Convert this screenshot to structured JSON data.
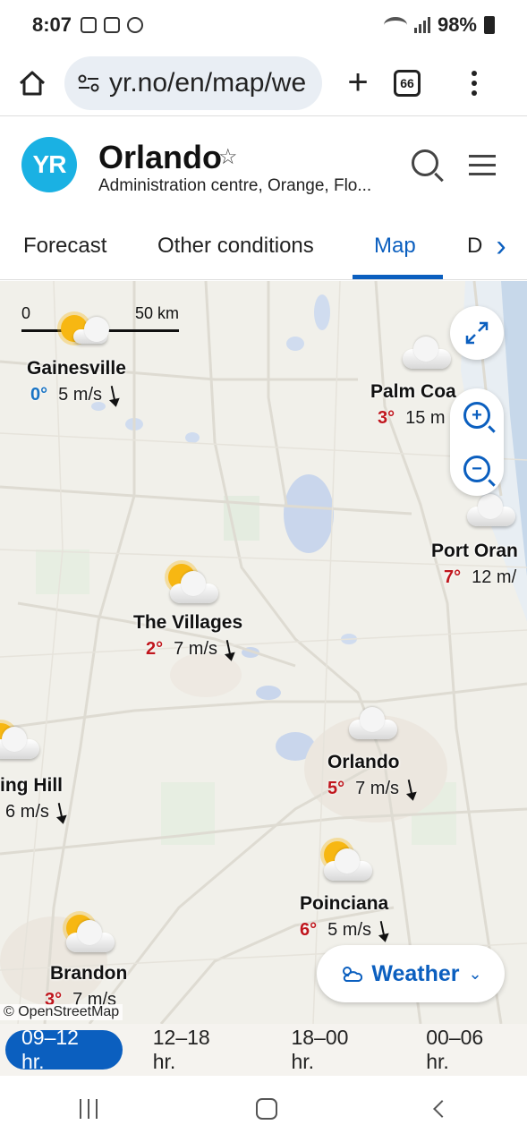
{
  "status_bar": {
    "time": "8:07",
    "battery": "98%"
  },
  "browser": {
    "url": "yr.no/en/map/we",
    "tabs_count": "66"
  },
  "header": {
    "logo_text": "YR",
    "city": "Orlando",
    "subtitle": "Administration centre, Orange, Flo..."
  },
  "nav_tabs": [
    {
      "label": "Forecast"
    },
    {
      "label": "Other conditions"
    },
    {
      "label": "Map"
    },
    {
      "label": "D"
    }
  ],
  "active_tab": "Map",
  "map": {
    "scale": {
      "zero": "0",
      "distance": "50 km"
    },
    "places": [
      {
        "name": "Gainesville",
        "temp": "0°",
        "wind": "5 m/s",
        "condition": "partly-cloudy"
      },
      {
        "name": "Palm Coa",
        "temp": "3°",
        "wind": "15 m",
        "condition": "cloudy"
      },
      {
        "name": "Port Oran",
        "temp": "7°",
        "wind": "12 m/",
        "condition": "cloudy"
      },
      {
        "name": "The Villages",
        "temp": "2°",
        "wind": "7 m/s",
        "condition": "partly-cloudy"
      },
      {
        "name": "ing Hill",
        "temp": "",
        "wind": "6 m/s",
        "condition": "partly-cloudy"
      },
      {
        "name": "Orlando",
        "temp": "5°",
        "wind": "7 m/s",
        "condition": "cloudy"
      },
      {
        "name": "Poinciana",
        "temp": "6°",
        "wind": "5 m/s",
        "condition": "partly-cloudy"
      },
      {
        "name": "Brandon",
        "temp": "3°",
        "wind": "7 m/s",
        "condition": "partly-cloudy"
      }
    ],
    "layer_button": "Weather",
    "attribution": "© OpenStreetMap"
  },
  "time_tabs": [
    {
      "label": "09–12 hr.",
      "active": true
    },
    {
      "label": "12–18 hr.",
      "active": false
    },
    {
      "label": "18–00 hr.",
      "active": false
    },
    {
      "label": "00–06 hr.",
      "active": false
    }
  ],
  "colors": {
    "accent": "#0b5fbf",
    "warm_temp": "#c0161d",
    "cold_temp": "#1a74c4",
    "logo": "#1ab1e3"
  }
}
